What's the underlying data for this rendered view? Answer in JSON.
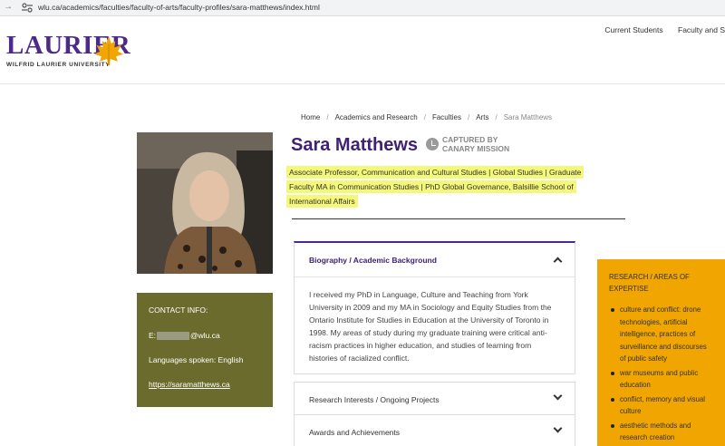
{
  "browser": {
    "forward_glyph": "→",
    "url": "wlu.ca/academics/faculties/faculty-of-arts/faculty-profiles/sara-matthews/index.html"
  },
  "header": {
    "logo_word": "LAURIER",
    "logo_sub": "WILFRID LAURIER UNIVERSITY",
    "logo_color": "#4b2a8a",
    "leaf_color": "#f0a500",
    "nav": [
      "Current Students",
      "Faculty and S"
    ]
  },
  "breadcrumb": {
    "items": [
      "Home",
      "Academics and Research",
      "Faculties",
      "Arts"
    ],
    "separator": "/",
    "current": "Sara Matthews"
  },
  "profile": {
    "name": "Sara Matthews",
    "canary_line1": "CAPTURED BY",
    "canary_line2": "CANARY MISSION",
    "title": "Associate Professor, Communication and Cultural Studies | Global Studies | Graduate Faculty MA in Communication Studies | PhD Global Governance, Balsillie School of International Affairs",
    "highlight_color": "#f3f77a"
  },
  "contact": {
    "title": "CONTACT INFO:",
    "email_prefix": "E:",
    "email_suffix": "@wlu.ca",
    "languages": "Languages spoken: English",
    "website": "https://saramatthews.ca",
    "bg_color": "#6b6b2e"
  },
  "accordion": [
    {
      "label": "Biography / Academic Background",
      "open": true,
      "body": "I received my PhD in Language, Culture and Teaching from York University in 2009 and my MA in Sociology and Equity Studies from the Ontario Institute for Studies in Education at the University of Toronto in 1998. My areas of study during my graduate training were critical anti-racism practices in higher education, and studies of learning from histories of racialized conflict."
    },
    {
      "label": "Research Interests / Ongoing Projects",
      "open": false
    },
    {
      "label": "Awards and Achievements",
      "open": false
    }
  ],
  "research": {
    "title": "RESEARCH / AREAS OF EXPERTISE",
    "bg_color": "#f0a500",
    "items": [
      "culture and conflict: drone technologies, artificial intelligence, practices of surveillance and discourses of public safety",
      "war museums and public education",
      "conflict, memory and visual culture",
      "aesthetic methods and research creation"
    ]
  }
}
